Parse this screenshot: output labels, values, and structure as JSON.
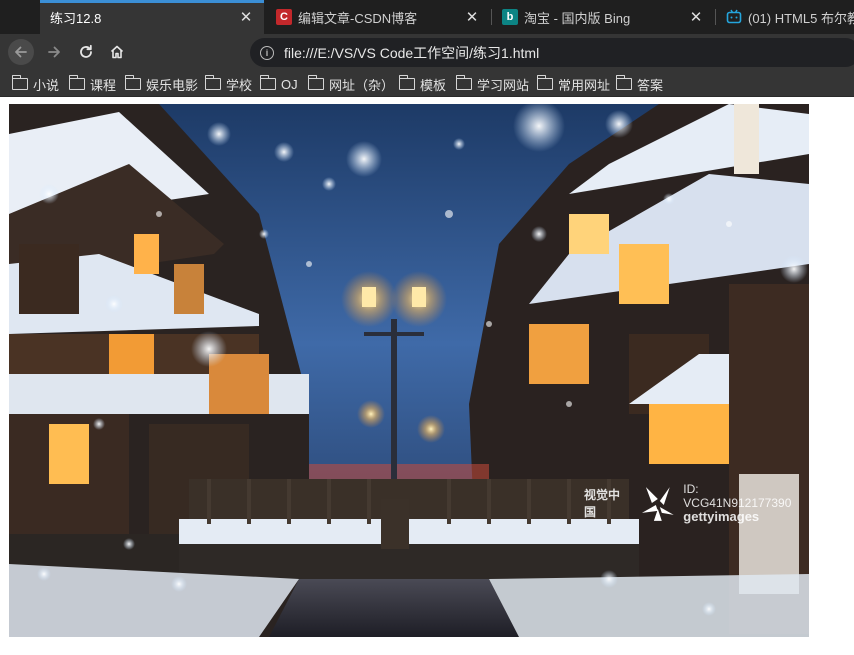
{
  "tabs": [
    {
      "title": "练习12.8",
      "active": true,
      "favicon": "blank-page-icon"
    },
    {
      "title": "编辑文章-CSDN博客",
      "active": false,
      "favicon": "csdn-icon",
      "favicon_letter": "C",
      "favicon_color": "#c3282b"
    },
    {
      "title": "淘宝 - 国内版 Bing",
      "active": false,
      "favicon": "bing-icon",
      "favicon_letter": "b",
      "favicon_color": "#0c8484"
    },
    {
      "title": "(01) HTML5 布尔教",
      "active": false,
      "favicon": "bilibili-icon",
      "favicon_color": "#24a5dc"
    }
  ],
  "toolbar": {
    "url": "file:///E:/VS/VS Code工作空间/练习1.html"
  },
  "bookmarks": [
    {
      "label": "小说"
    },
    {
      "label": "课程"
    },
    {
      "label": "娱乐电影"
    },
    {
      "label": "学校"
    },
    {
      "label": "OJ"
    },
    {
      "label": "网址（杂）"
    },
    {
      "label": "模板"
    },
    {
      "label": "学习网站"
    },
    {
      "label": "常用网址"
    },
    {
      "label": "答案"
    }
  ],
  "photo": {
    "watermark_cn": "视觉中国",
    "watermark_id": "ID: VCG41N912177390",
    "watermark_brand": "gettyimages"
  },
  "colors": {
    "accent": "#3b8fd6",
    "tab_bar": "#1f1f1f",
    "toolbar": "#353535",
    "omnibox": "#202124"
  }
}
